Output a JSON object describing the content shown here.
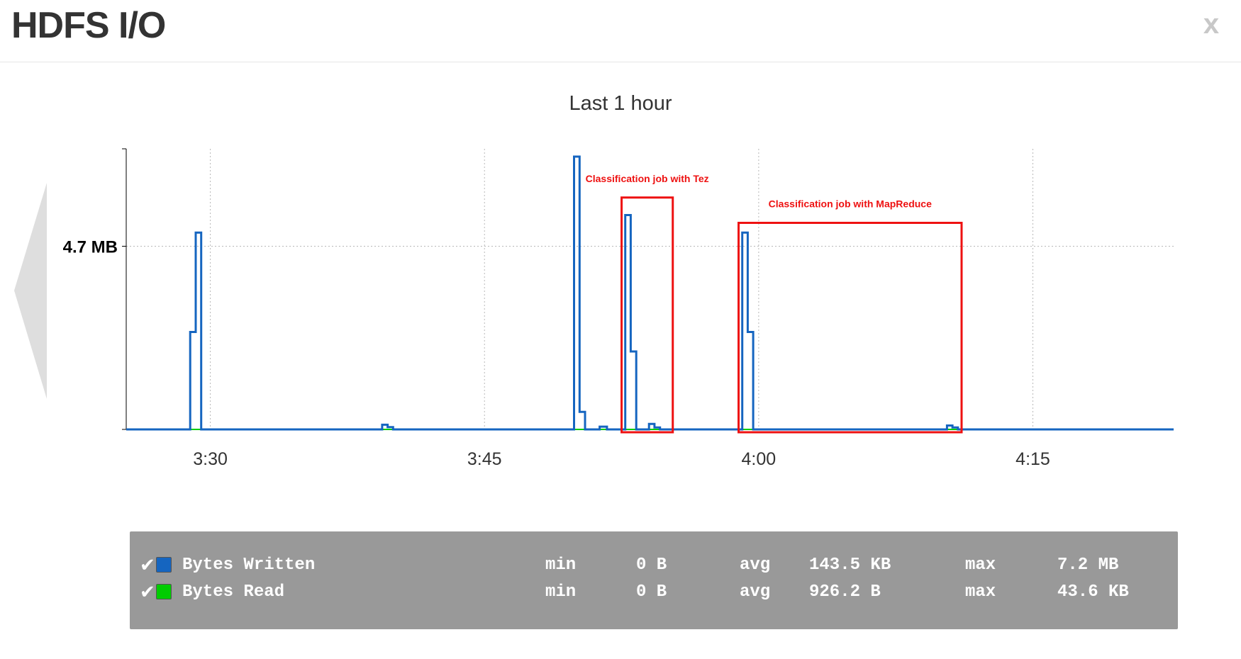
{
  "header": {
    "title": "HDFS I/O",
    "close_label": "x"
  },
  "chart_data": {
    "type": "line",
    "title": "Last 1 hour",
    "xlabel": "",
    "ylabel": "",
    "x_unit": "minutes",
    "x_tick_labels": [
      {
        "x": 210,
        "label": "3:30"
      },
      {
        "x": 225,
        "label": "3:45"
      },
      {
        "x": 240,
        "label": "4:00"
      },
      {
        "x": 255,
        "label": "4:15"
      }
    ],
    "xlim": [
      205.4,
      262.7
    ],
    "y_tick_labels": [
      {
        "y": 4.7,
        "label": "4.7 MB"
      }
    ],
    "ylim": [
      0,
      7.2
    ],
    "grid": true,
    "interpolation": "step",
    "series": [
      {
        "name": "Bytes Written",
        "color": "#1565c0",
        "points": [
          [
            205.4,
            0
          ],
          [
            208.9,
            0
          ],
          [
            208.9,
            2.5
          ],
          [
            209.2,
            2.5
          ],
          [
            209.2,
            5.05
          ],
          [
            209.5,
            5.05
          ],
          [
            209.5,
            0
          ],
          [
            219.4,
            0
          ],
          [
            219.4,
            0.12
          ],
          [
            219.7,
            0.12
          ],
          [
            219.7,
            0.06
          ],
          [
            220.0,
            0.06
          ],
          [
            220.0,
            0
          ],
          [
            229.9,
            0
          ],
          [
            229.9,
            7.0
          ],
          [
            230.2,
            7.0
          ],
          [
            230.2,
            0.45
          ],
          [
            230.5,
            0.45
          ],
          [
            230.5,
            0
          ],
          [
            231.3,
            0
          ],
          [
            231.3,
            0.07
          ],
          [
            231.7,
            0.07
          ],
          [
            231.7,
            0
          ],
          [
            232.7,
            0
          ],
          [
            232.7,
            5.5
          ],
          [
            233.0,
            5.5
          ],
          [
            233.0,
            2.0
          ],
          [
            233.3,
            2.0
          ],
          [
            233.3,
            0
          ],
          [
            234.0,
            0
          ],
          [
            234.0,
            0.14
          ],
          [
            234.3,
            0.14
          ],
          [
            234.3,
            0.05
          ],
          [
            234.6,
            0.05
          ],
          [
            234.6,
            0
          ],
          [
            239.1,
            0
          ],
          [
            239.1,
            5.05
          ],
          [
            239.4,
            5.05
          ],
          [
            239.4,
            2.5
          ],
          [
            239.7,
            2.5
          ],
          [
            239.7,
            0
          ],
          [
            250.3,
            0
          ],
          [
            250.3,
            0.1
          ],
          [
            250.6,
            0.1
          ],
          [
            250.6,
            0.05
          ],
          [
            250.9,
            0.05
          ],
          [
            250.9,
            0
          ],
          [
            262.7,
            0
          ]
        ]
      },
      {
        "name": "Bytes Read",
        "color": "#00cc00",
        "points": [
          [
            205.4,
            0
          ],
          [
            262.7,
            0
          ]
        ]
      }
    ],
    "annotations": [
      {
        "label": "Classification job with Tez",
        "x_range": [
          232.5,
          235.3
        ],
        "y_top": 5.95
      },
      {
        "label": "Classification job with MapReduce",
        "x_range": [
          238.9,
          251.1
        ],
        "y_top": 5.3
      }
    ],
    "annotation_color": "#ee1111",
    "legend": {
      "placement": "bottom",
      "rows": [
        {
          "check": "✔",
          "name": "Bytes Written",
          "color": "#1565c0",
          "min_label": "min",
          "min": "0 B",
          "avg_label": "avg",
          "avg": "143.5 KB",
          "max_label": "max",
          "max": "7.2 MB"
        },
        {
          "check": "✔",
          "name": "Bytes Read",
          "color": "#00cc00",
          "min_label": "min",
          "min": "0 B",
          "avg_label": "avg",
          "avg": "926.2 B",
          "max_label": "max",
          "max": "43.6 KB"
        }
      ]
    }
  }
}
